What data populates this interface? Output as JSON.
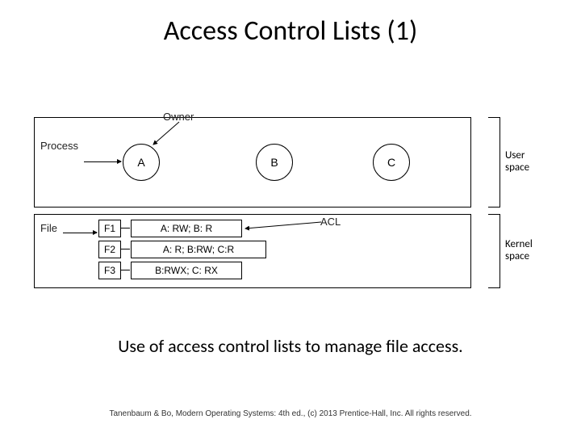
{
  "title": "Access Control Lists (1)",
  "caption": "Use of access control lists to manage file access.",
  "footer": "Tanenbaum & Bo, Modern Operating Systems: 4th ed., (c) 2013 Prentice-Hall, Inc. All rights reserved.",
  "labels": {
    "process": "Process",
    "owner": "Owner",
    "file": "File",
    "acl": "ACL",
    "user_space": "User space",
    "kernel_space": "Kernel space"
  },
  "processes": {
    "A": "A",
    "B": "B",
    "C": "C"
  },
  "files": [
    {
      "name": "F1",
      "acl": "A: RW;  B: R"
    },
    {
      "name": "F2",
      "acl": "A: R;  B:RW;  C:R"
    },
    {
      "name": "F3",
      "acl": "B:RWX;  C: RX"
    }
  ]
}
